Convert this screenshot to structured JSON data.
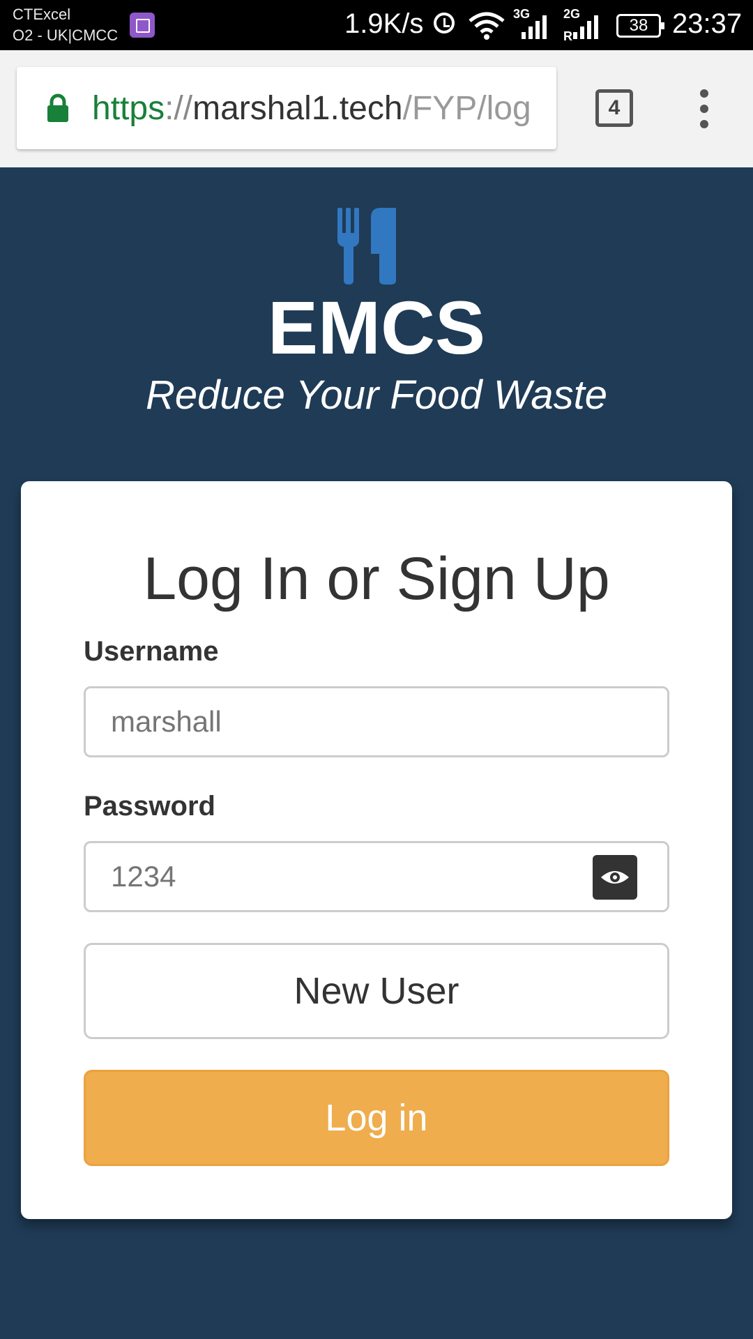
{
  "status_bar": {
    "carrier_line1": "CTExcel",
    "carrier_line2": "O2 - UK|CMCC",
    "net_speed": "1.9K/s",
    "signal1_label": "3G",
    "signal2_label": "2G",
    "signal2_sub": "R",
    "battery": "38",
    "time": "23:37"
  },
  "browser": {
    "url_scheme": "https",
    "url_sep": "://",
    "url_host": "marshal1.tech",
    "url_path": "/FYP/log",
    "tab_count": "4"
  },
  "header": {
    "app_name": "EMCS",
    "tagline": "Reduce Your Food Waste",
    "logo_color": "#3178c0"
  },
  "login_card": {
    "title": "Log In or Sign Up",
    "username_label": "Username",
    "username_placeholder": "marshall",
    "password_label": "Password",
    "password_placeholder": "1234",
    "new_user_button": "New User",
    "login_button": "Log in",
    "accent_color": "#efad4e"
  }
}
